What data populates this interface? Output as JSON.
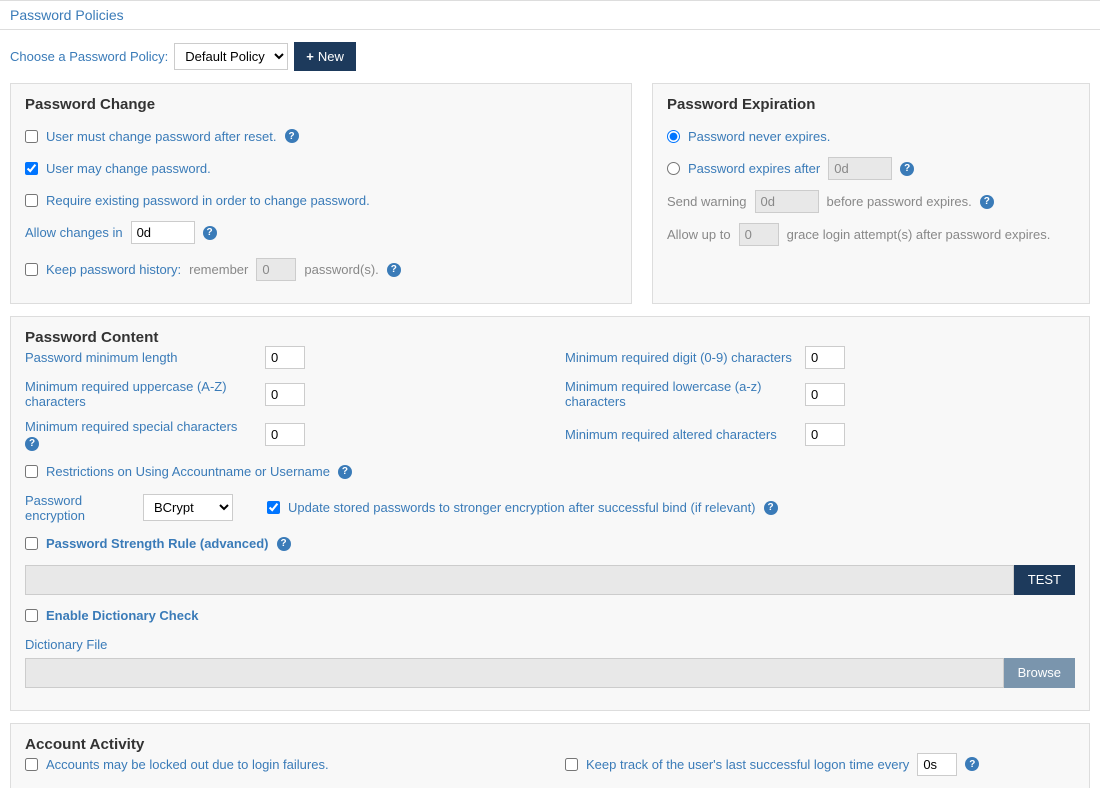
{
  "header": {
    "title": "Password Policies"
  },
  "toolbar": {
    "choose_label": "Choose a Password Policy:",
    "policy_selected": "Default Policy",
    "new_label": "New"
  },
  "password_change": {
    "heading": "Password Change",
    "must_change_label": "User must change password after reset.",
    "may_change_label": "User may change password.",
    "require_existing_label": "Require existing password in order to change password.",
    "allow_changes_label": "Allow changes in",
    "allow_changes_value": "0d",
    "keep_history_label": "Keep password history:",
    "remember_label": "remember",
    "remember_value": "0",
    "passwords_suffix": "password(s)."
  },
  "password_expiration": {
    "heading": "Password Expiration",
    "never_label": "Password never expires.",
    "expires_after_label": "Password expires after",
    "expires_after_value": "0d",
    "send_warning_label": "Send warning",
    "send_warning_value": "0d",
    "send_warning_suffix": "before password expires.",
    "allow_up_to_label": "Allow up to",
    "allow_up_to_value": "0",
    "grace_suffix": "grace login attempt(s) after password expires."
  },
  "password_content": {
    "heading": "Password Content",
    "min_length_label": "Password minimum length",
    "min_length_value": "0",
    "min_upper_label": "Minimum required uppercase (A-Z) characters",
    "min_upper_value": "0",
    "min_special_label": "Minimum required special characters",
    "min_special_value": "0",
    "min_digit_label": "Minimum required digit (0-9) characters",
    "min_digit_value": "0",
    "min_lower_label": "Minimum required lowercase (a-z) characters",
    "min_lower_value": "0",
    "min_altered_label": "Minimum required altered characters",
    "min_altered_value": "0",
    "restrictions_label": "Restrictions on Using Accountname or Username",
    "encryption_label": "Password encryption",
    "encryption_selected": "BCrypt",
    "update_stored_label": "Update stored passwords to stronger encryption after successful bind (if relevant)",
    "strength_rule_label": "Password Strength Rule (advanced)",
    "test_button": "TEST",
    "enable_dict_label": "Enable Dictionary Check",
    "dict_file_label": "Dictionary File",
    "browse_button": "Browse"
  },
  "account_activity": {
    "heading": "Account Activity",
    "lockout_label": "Accounts may be locked out due to login failures.",
    "track_label": "Keep track of the user's last successful logon time every",
    "track_value": "0s"
  }
}
